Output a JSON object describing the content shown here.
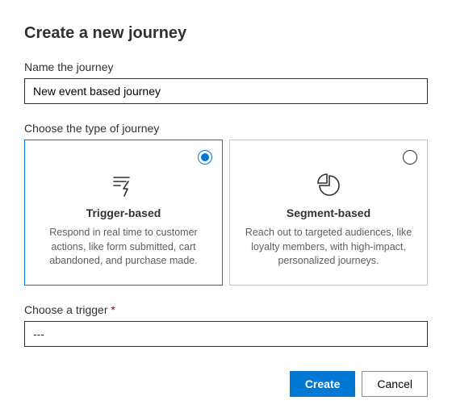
{
  "dialog": {
    "title": "Create a new journey"
  },
  "name_field": {
    "label": "Name the journey",
    "value": "New event based journey"
  },
  "type_section": {
    "label": "Choose the type of journey",
    "options": [
      {
        "title": "Trigger-based",
        "description": "Respond in real time to customer actions, like form submitted, cart abandoned, and purchase made.",
        "selected": true
      },
      {
        "title": "Segment-based",
        "description": "Reach out to targeted audiences, like loyalty members, with high-impact, personalized journeys.",
        "selected": false
      }
    ]
  },
  "trigger_field": {
    "label": "Choose a trigger",
    "required_marker": "*",
    "value": "---"
  },
  "footer": {
    "create": "Create",
    "cancel": "Cancel"
  }
}
